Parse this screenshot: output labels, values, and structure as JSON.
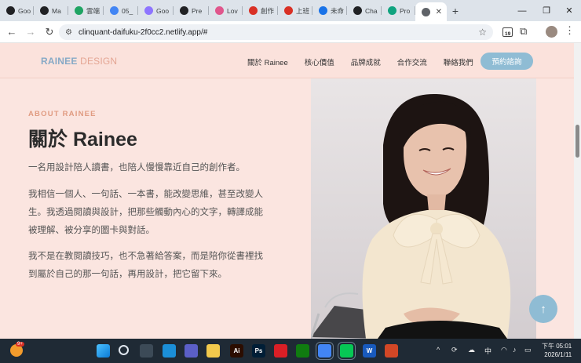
{
  "browser": {
    "tabs": [
      {
        "label": "Goo",
        "color": "#202124"
      },
      {
        "label": "Ma",
        "color": "#202124"
      },
      {
        "label": "雲端",
        "color": "#1fa463"
      },
      {
        "label": "05_",
        "color": "#4285f4"
      },
      {
        "label": "Goo",
        "color": "#8e75ff"
      },
      {
        "label": "Pre",
        "color": "#202124"
      },
      {
        "label": "Lov",
        "color": "#e0568c"
      },
      {
        "label": "創作",
        "color": "#d93025"
      },
      {
        "label": "上班",
        "color": "#d93025"
      },
      {
        "label": "未命",
        "color": "#1a73e8"
      },
      {
        "label": "Cha",
        "color": "#202124"
      },
      {
        "label": "Pro",
        "color": "#10a37f"
      }
    ],
    "active_tab_close": "✕",
    "new_tab": "+",
    "url": "clinquant-daifuku-2f0cc2.netlify.app/#",
    "extension_badge": "19"
  },
  "site": {
    "brand_a": "RAINEE",
    "brand_b": " DESIGN",
    "nav": [
      "關於 Rainee",
      "核心價值",
      "品牌成就",
      "合作交流",
      "聯絡我們"
    ],
    "cta": "預約諮詢"
  },
  "hero": {
    "kicker": "ABOUT RAINEE",
    "title": "關於 Rainee",
    "p1": "一名用設計陪人讀書，也陪人慢慢靠近自己的創作者。",
    "p2a": "我相信一個人、一句話、一本書，能改變思維，甚至改變人",
    "p2b": "生。我透過閱讀與設計，把那些觸動內心的文字，轉譯成能",
    "p2c": "被理解、被分享的圖卡與對話。",
    "p3a": "我不是在教閱讀技巧，也不急著給答案，而是陪你從書裡找",
    "p3b": "到屬於自己的那一句話，再用設計，把它留下來。",
    "scroll_top": "↑"
  },
  "taskbar": {
    "weather_badge": "9+",
    "apps": [
      {
        "name": "start",
        "color": "#2a9df4",
        "glyph": ""
      },
      {
        "name": "search",
        "color": "transparent",
        "glyph": ""
      },
      {
        "name": "taskview",
        "color": "#3c4a57",
        "glyph": ""
      },
      {
        "name": "edge",
        "color": "#1b8fd8",
        "glyph": ""
      },
      {
        "name": "teams",
        "color": "#5b5fc7",
        "glyph": ""
      },
      {
        "name": "explorer",
        "color": "#f2c94c",
        "glyph": ""
      },
      {
        "name": "illustrator",
        "color": "#2b0d00",
        "glyph": "Ai"
      },
      {
        "name": "photoshop",
        "color": "#001e36",
        "glyph": "Ps"
      },
      {
        "name": "creative-cloud",
        "color": "#da1f26",
        "glyph": ""
      },
      {
        "name": "xbox",
        "color": "#107c10",
        "glyph": ""
      },
      {
        "name": "chrome",
        "color": "#4285f4",
        "glyph": ""
      },
      {
        "name": "line",
        "color": "#06c755",
        "glyph": ""
      },
      {
        "name": "word",
        "color": "#185abd",
        "glyph": "W"
      },
      {
        "name": "powerpoint",
        "color": "#d24726",
        "glyph": ""
      }
    ],
    "ime": "中",
    "time": "下午 05:01",
    "date": "2026/1/11"
  }
}
